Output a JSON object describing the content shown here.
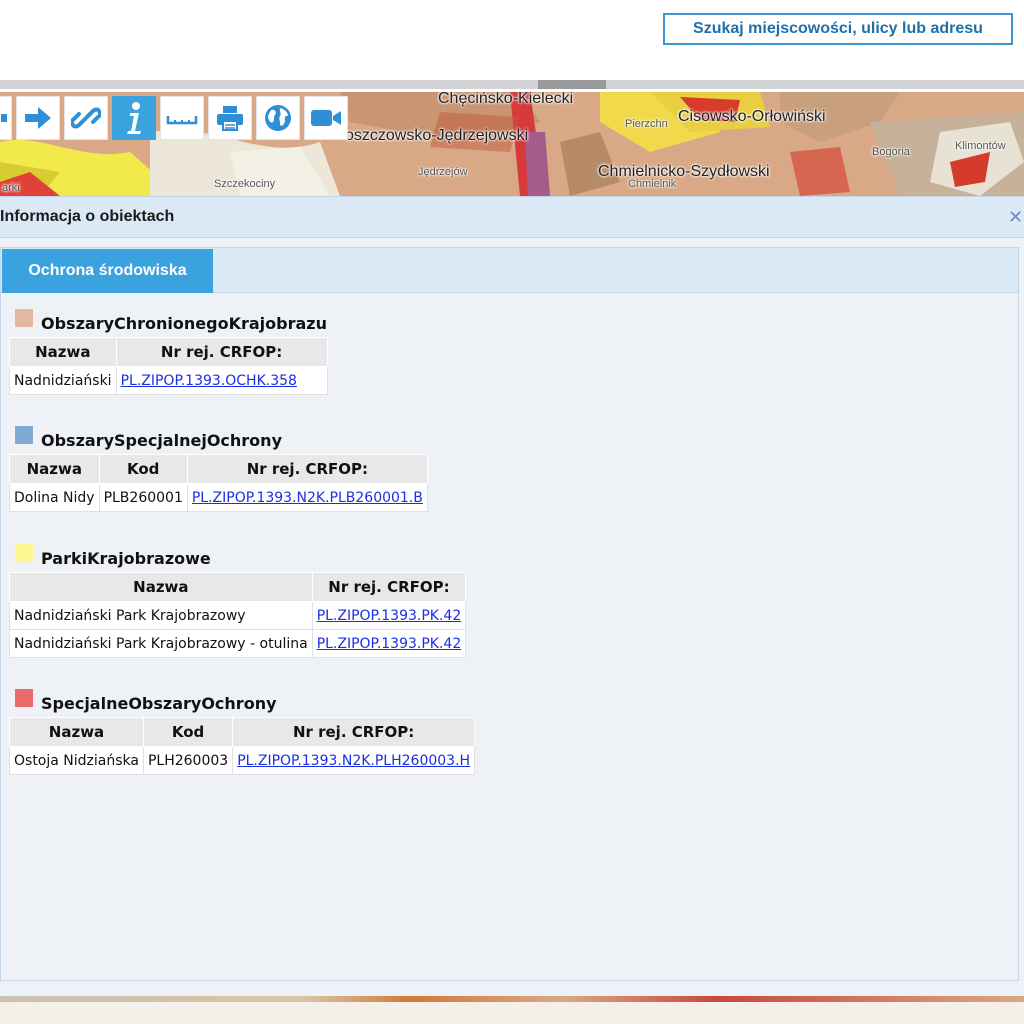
{
  "header": {
    "search_button": "Szukaj miejscowości, ulicy lub adresu"
  },
  "map": {
    "labels": {
      "a": "Chęcińsko-Kielecki",
      "b": "Cisowsko-Orłowiński",
      "c": "oszczowsko-Jędrzejowski",
      "d": "Chmielnicko-Szydłowski",
      "e": "Jędrzejów",
      "f": "Szczekociny",
      "g": "Bogoria",
      "h": "Klimontów",
      "i": "Pierzchn",
      "j": "Chmielnik",
      "k": "arki"
    }
  },
  "toolbar": {
    "icons": [
      "arrow-right-icon",
      "link-icon",
      "info-icon",
      "measure-icon",
      "print-icon",
      "globe-icon",
      "video-icon"
    ],
    "active": "info-icon",
    "accent": "#3ba2e0"
  },
  "panel": {
    "title": "Informacja o obiektach",
    "close_icon": "close-icon",
    "tab": "Ochrona środowiska"
  },
  "layers": [
    {
      "name": "ObszaryChronionegoKrajobrazu",
      "color": "#e3b8a0",
      "columns": [
        "Nazwa",
        "Nr rej. CRFOP:"
      ],
      "rows": [
        [
          "Nadnidziański",
          "PL.ZIPOP.1393.OCHK.358"
        ]
      ]
    },
    {
      "name": "ObszarySpecjalnejOchrony",
      "color": "#7eaad3",
      "columns": [
        "Nazwa",
        "Kod",
        "Nr rej. CRFOP:"
      ],
      "rows": [
        [
          "Dolina Nidy",
          "PLB260001",
          "PL.ZIPOP.1393.N2K.PLB260001.B"
        ]
      ]
    },
    {
      "name": "ParkiKrajobrazowe",
      "color": "#fbf890",
      "columns": [
        "Nazwa",
        "Nr rej. CRFOP:"
      ],
      "rows": [
        [
          "Nadnidziański Park Krajobrazowy",
          "PL.ZIPOP.1393.PK.42"
        ],
        [
          "Nadnidziański Park Krajobrazowy - otulina",
          "PL.ZIPOP.1393.PK.42"
        ]
      ]
    },
    {
      "name": "SpecjalneObszaryOchrony",
      "color": "#e86a6a",
      "columns": [
        "Nazwa",
        "Kod",
        "Nr rej. CRFOP:"
      ],
      "rows": [
        [
          "Ostoja Nidziańska",
          "PLH260003",
          "PL.ZIPOP.1393.N2K.PLH260003.H"
        ]
      ]
    }
  ]
}
